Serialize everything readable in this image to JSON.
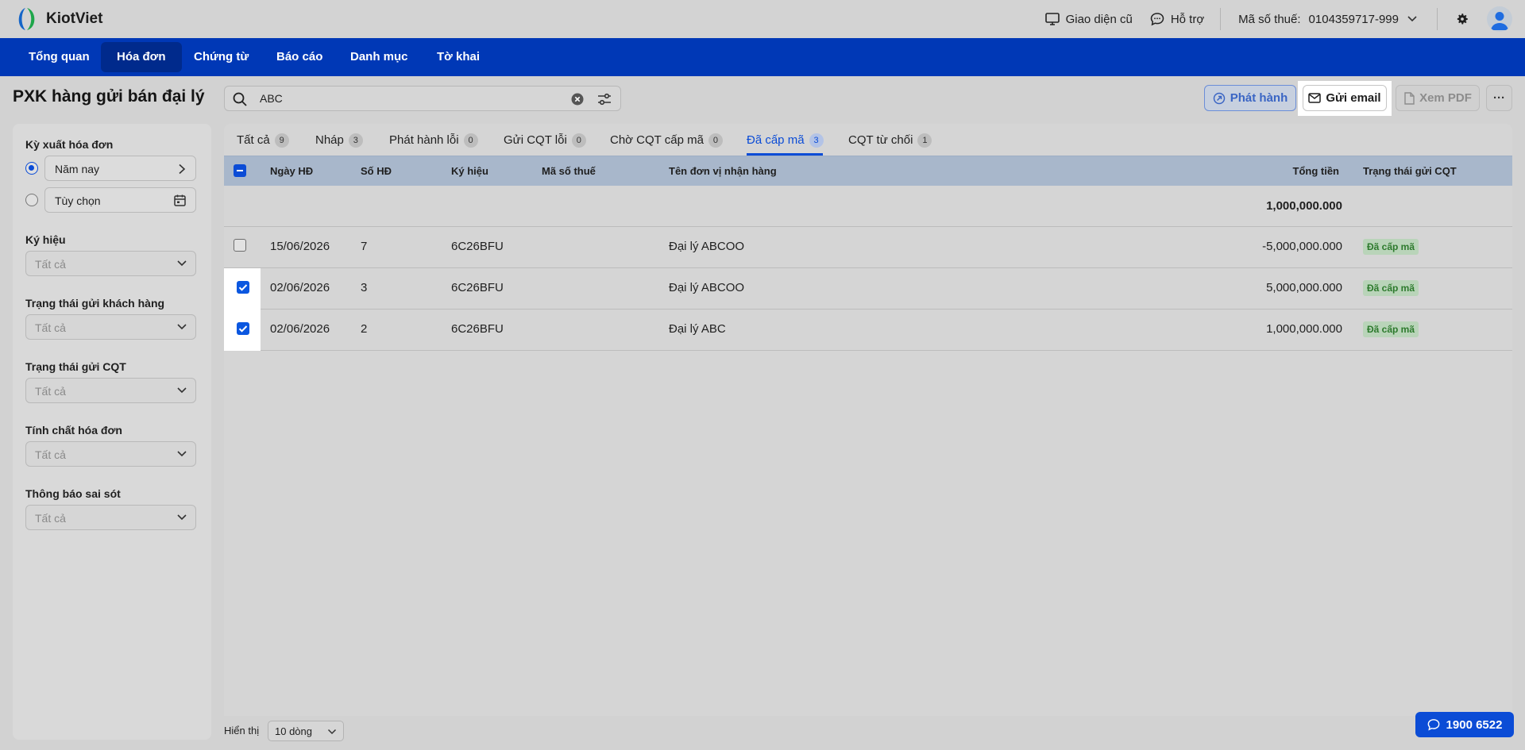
{
  "app": {
    "name": "KiotViet"
  },
  "header": {
    "old_ui_label": "Giao diện cũ",
    "support_label": "Hỗ trợ",
    "tax_code_label": "Mã số thuế:",
    "tax_code_value": "0104359717-999"
  },
  "nav": {
    "items": [
      {
        "label": "Tổng quan"
      },
      {
        "label": "Hóa đơn"
      },
      {
        "label": "Chứng từ"
      },
      {
        "label": "Báo cáo"
      },
      {
        "label": "Danh mục"
      },
      {
        "label": "Tờ khai"
      }
    ],
    "active": "Hóa đơn"
  },
  "page": {
    "title": "PXK hàng gửi bán đại lý"
  },
  "search": {
    "value": "ABC"
  },
  "toolbar": {
    "publish_label": "Phát hành",
    "email_label": "Gửi email",
    "pdf_label": "Xem PDF",
    "more_label": "···"
  },
  "filters": {
    "period": {
      "label": "Kỳ xuất hóa đơn",
      "option_year": "Năm nay",
      "option_custom": "Tùy chọn",
      "selected": "Năm nay"
    },
    "symbol": {
      "label": "Ký hiệu",
      "value": "Tất cả"
    },
    "customer_send_status": {
      "label": "Trạng thái gửi khách hàng",
      "value": "Tất cả"
    },
    "cqt_send_status": {
      "label": "Trạng thái gửi CQT",
      "value": "Tất cả"
    },
    "invoice_nature": {
      "label": "Tính chất hóa đơn",
      "value": "Tất cả"
    },
    "error_notice": {
      "label": "Thông báo sai sót",
      "value": "Tất cả"
    }
  },
  "tabs": [
    {
      "label": "Tất cả",
      "count": "9"
    },
    {
      "label": "Nháp",
      "count": "3"
    },
    {
      "label": "Phát hành lỗi",
      "count": "0"
    },
    {
      "label": "Gửi CQT lỗi",
      "count": "0"
    },
    {
      "label": "Chờ CQT cấp mã",
      "count": "0"
    },
    {
      "label": "Đã cấp mã",
      "count": "3"
    },
    {
      "label": "CQT từ chối",
      "count": "1"
    }
  ],
  "active_tab": "Đã cấp mã",
  "table": {
    "columns": {
      "date": "Ngày HĐ",
      "number": "Số HĐ",
      "symbol": "Ký hiệu",
      "tax_code": "Mã số thuế",
      "receiver": "Tên đơn vị nhận hàng",
      "total": "Tổng tiền",
      "cqt_status": "Trạng thái gửi CQT"
    },
    "summary_total": "1,000,000.000",
    "rows": [
      {
        "checked": false,
        "date": "15/06/2026",
        "number": "7",
        "symbol": "6C26BFU",
        "tax_code": "",
        "receiver": "Đại lý ABCOO",
        "total": "-5,000,000.000",
        "status": "Đã cấp mã"
      },
      {
        "checked": true,
        "date": "02/06/2026",
        "number": "3",
        "symbol": "6C26BFU",
        "tax_code": "",
        "receiver": "Đại lý ABCOO",
        "total": "5,000,000.000",
        "status": "Đã cấp mã"
      },
      {
        "checked": true,
        "date": "02/06/2026",
        "number": "2",
        "symbol": "6C26BFU",
        "tax_code": "",
        "receiver": "Đại lý ABC",
        "total": "1,000,000.000",
        "status": "Đã cấp mã"
      }
    ]
  },
  "footer": {
    "show_label": "Hiển thị",
    "page_size": "10 dòng"
  },
  "hotline": {
    "number": "1900 6522"
  },
  "colors": {
    "nav_bg": "#0038b6",
    "accent": "#0b4cd6",
    "badge_bg": "#b9d4b9",
    "badge_text": "#2d7a2d"
  }
}
